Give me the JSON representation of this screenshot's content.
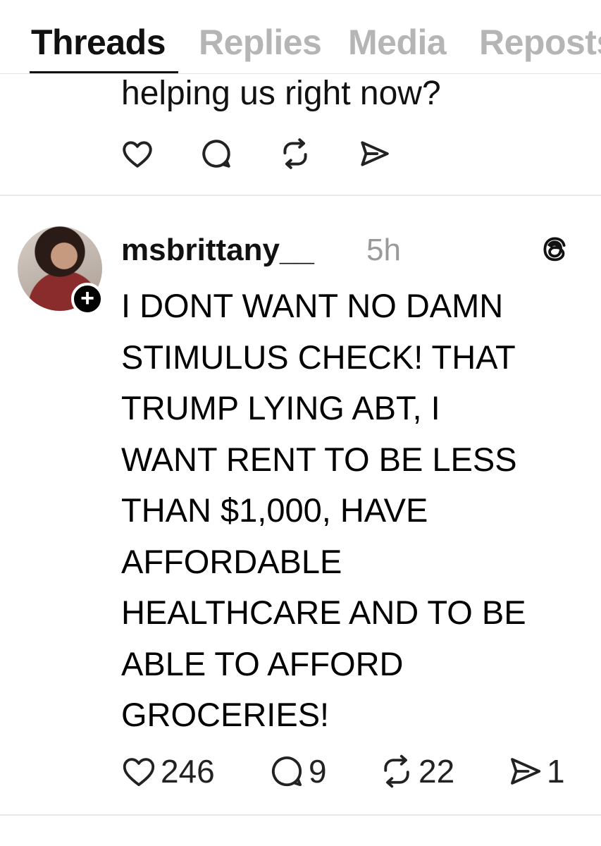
{
  "tabs": [
    {
      "label": "Threads",
      "active": true
    },
    {
      "label": "Replies",
      "active": false
    },
    {
      "label": "Media",
      "active": false
    },
    {
      "label": "Reposts",
      "active": false
    }
  ],
  "previous_post": {
    "text": "helping us right now?",
    "actions": [
      "heart-icon",
      "comment-icon",
      "repost-icon",
      "share-icon"
    ]
  },
  "post": {
    "username": "msbrittany__",
    "timestamp": "5h",
    "follow_badge": "+",
    "body": "I DONT WANT NO DAMN\nSTIMULUS CHECK! THAT\nTRUMP LYING ABT, I\nWANT RENT TO BE LESS\nTHAN $1,000,  HAVE\nAFFORDABLE\nHEALTHCARE AND TO BE\nABLE TO AFFORD\nGROCERIES!",
    "likes": "246",
    "comments": "9",
    "reposts": "22",
    "shares": "1"
  },
  "colors": {
    "active_tab": "#111111",
    "inactive_tab": "#b5b5b5",
    "timestamp": "#9a9a9a",
    "divider": "#e8e8e8"
  }
}
